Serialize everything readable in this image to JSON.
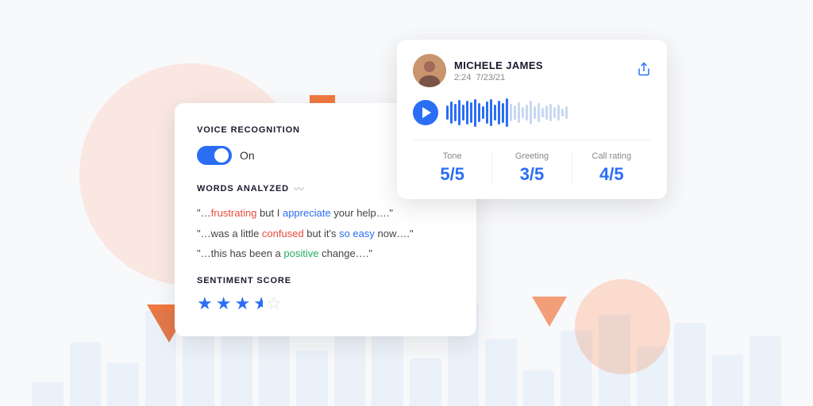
{
  "background": {
    "bars": [
      30,
      80,
      55,
      120,
      90,
      150,
      110,
      70,
      140,
      100,
      60,
      130,
      85,
      45,
      95,
      115,
      75,
      105,
      65,
      88
    ]
  },
  "voice_card": {
    "title": "VOICE RECOGNITION",
    "toggle_label": "On",
    "toggle_on": true,
    "words_analyzed_title": "WORDS ANALYZED",
    "quotes": [
      {
        "prefix": "\"…",
        "word1": "frustrating",
        "word1_color": "red",
        "mid1": " but I ",
        "word2": "appreciate",
        "word2_color": "blue",
        "mid2": " your help….\"",
        "suffix": ""
      },
      {
        "prefix": "\"…was a little ",
        "word1": "confused",
        "word1_color": "red",
        "mid1": " but it's ",
        "word2": "so easy",
        "word2_color": "blue",
        "mid2": " now….\"",
        "suffix": ""
      },
      {
        "prefix": "\"…this has been a ",
        "word1": "positive",
        "word1_color": "green",
        "mid1": " change….\"",
        "word2": "",
        "word2_color": "",
        "mid2": "",
        "suffix": ""
      }
    ],
    "sentiment_title": "SENTIMENT SCORE",
    "stars_filled": 3,
    "stars_half": 1,
    "stars_empty": 1
  },
  "audio_card": {
    "user_name": "MICHELE JAMES",
    "user_time": "2:24",
    "user_date": "7/23/21",
    "metrics": [
      {
        "label": "Tone",
        "value": "5/5"
      },
      {
        "label": "Greeting",
        "value": "3/5"
      },
      {
        "label": "Call rating",
        "value": "4/5"
      }
    ]
  }
}
